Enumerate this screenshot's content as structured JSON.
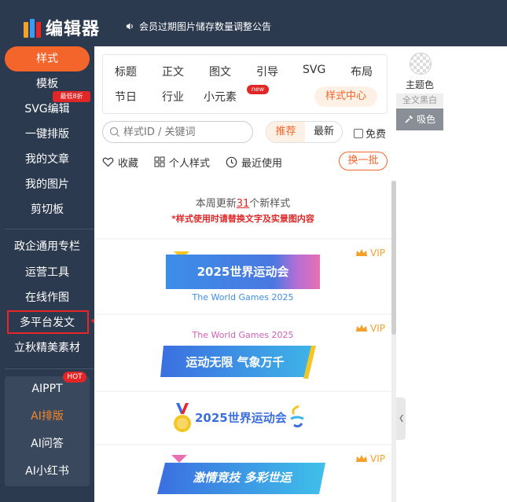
{
  "header": {
    "app_name": "编辑器",
    "notice": "会员过期图片储存数量调整公告",
    "logo_colors": [
      "#f3a12b",
      "#3b9bf3",
      "#e8262a"
    ]
  },
  "sidebar": {
    "active_label": "样式",
    "discount_badge": "最低8折",
    "items_group1": [
      "模板",
      "SVG编辑",
      "一键排版",
      "我的文章",
      "我的图片",
      "剪切板"
    ],
    "items_group2": [
      "政企通用专栏",
      "运营工具",
      "在线作图",
      "多平台发文",
      "立秋精美素材"
    ],
    "ai_items": [
      "AIPPT",
      "AI排版",
      "AI问答",
      "AI小红书"
    ],
    "hot_badge": "HOT",
    "highlighted": "多平台发文"
  },
  "tabs": {
    "row1": [
      "标题",
      "正文",
      "图文",
      "引导",
      "SVG",
      "布局"
    ],
    "row2": [
      "节日",
      "行业",
      "小元素"
    ],
    "new_badge": "new",
    "center_label": "样式中心"
  },
  "search": {
    "placeholder": "样式ID / 关键词"
  },
  "sort": {
    "recommend": "推荐",
    "latest": "最新",
    "free": "免费"
  },
  "filters": {
    "favorites": "收藏",
    "personal": "个人样式",
    "recent": "最近使用",
    "refresh": "换一批"
  },
  "content": {
    "intro_prefix": "本周更新",
    "intro_num": "31",
    "intro_suffix": "个新样式",
    "intro_warn": "*样式使用时请替换文字及实景图内容",
    "vip": "VIP",
    "card1_title": "2025世界运动会",
    "card1_sub": "The World Games 2025",
    "card2_sub": "The World Games 2025",
    "card2_title": "运动无限 气象万千",
    "card3_title": "2025世界运动会",
    "card4_title": "激情竞技 多彩世运"
  },
  "right_panel": {
    "theme_label": "主题色",
    "bw_label": "全文黑白",
    "picker_label": "吸色"
  },
  "colors": {
    "accent": "#f3652b",
    "sidebar_bg": "#2c3a4f",
    "highlight_red": "#e8262a"
  }
}
